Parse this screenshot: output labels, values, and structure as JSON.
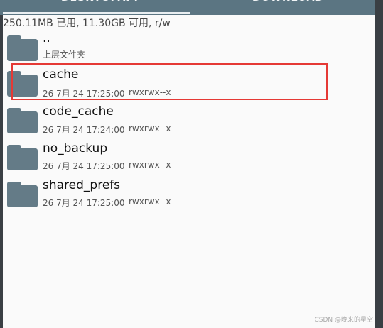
{
  "tabs": [
    {
      "label": "DESKTOPAPP"
    },
    {
      "label": "DOWNLOAD"
    }
  ],
  "storage_info": "250.11MB 已用, 11.30GB 可用, r/w",
  "files": [
    {
      "name": "..",
      "subtitle": "上层文件夹",
      "date": "",
      "permissions": ""
    },
    {
      "name": "cache",
      "subtitle": "",
      "date": "26 7月 24 17:25:00",
      "permissions": "rwxrwx--x"
    },
    {
      "name": "code_cache",
      "subtitle": "",
      "date": "26 7月 24 17:24:00",
      "permissions": "rwxrwx--x"
    },
    {
      "name": "no_backup",
      "subtitle": "",
      "date": "26 7月 24 17:25:00",
      "permissions": "rwxrwx--x"
    },
    {
      "name": "shared_prefs",
      "subtitle": "",
      "date": "26 7月 24 17:25:00",
      "permissions": "rwxrwx--x"
    }
  ],
  "watermark": "CSDN @晚来的星空",
  "colors": {
    "toolbar": "#5b7582",
    "folder": "#647b87",
    "highlight": "#e53935"
  }
}
